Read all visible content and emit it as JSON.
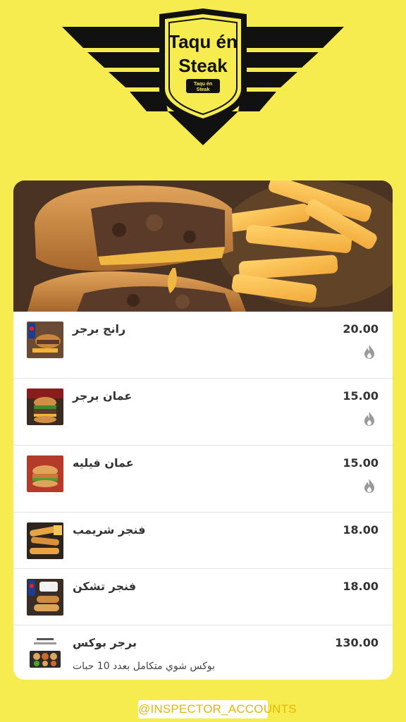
{
  "brand": {
    "logo_line1": "Taqu én",
    "logo_line2": "Steak",
    "logo_small1": "Taqu én",
    "logo_small2": "Steak"
  },
  "menu": {
    "items": [
      {
        "name": "رانج برجر",
        "price": "20.00",
        "spicy": true,
        "thumb_icon": "burger-combo-photo"
      },
      {
        "name": "عمان برجر",
        "price": "15.00",
        "spicy": true,
        "thumb_icon": "burger-photo"
      },
      {
        "name": "عمان فيليه",
        "price": "15.00",
        "spicy": true,
        "thumb_icon": "fillet-sandwich-photo"
      },
      {
        "name": "فنجر شريمب",
        "price": "18.00",
        "spicy": false,
        "thumb_icon": "shrimp-fingers-photo"
      },
      {
        "name": "فنجر تشكن",
        "price": "18.00",
        "spicy": false,
        "thumb_icon": "chicken-fingers-photo"
      },
      {
        "name": "برجر بوكس",
        "price": "130.00",
        "spicy": false,
        "description": "بوكس شوي متكامل بعدد 10 حبات",
        "thumb_icon": "burger-box-photo"
      }
    ]
  },
  "footer": {
    "handle": "@INSPECTOR_ACCOUNTS"
  },
  "colors": {
    "background": "#f7ec4f",
    "logo_black": "#111111",
    "handle_text": "#e6b800",
    "flame_gray": "#9a9a9a"
  }
}
